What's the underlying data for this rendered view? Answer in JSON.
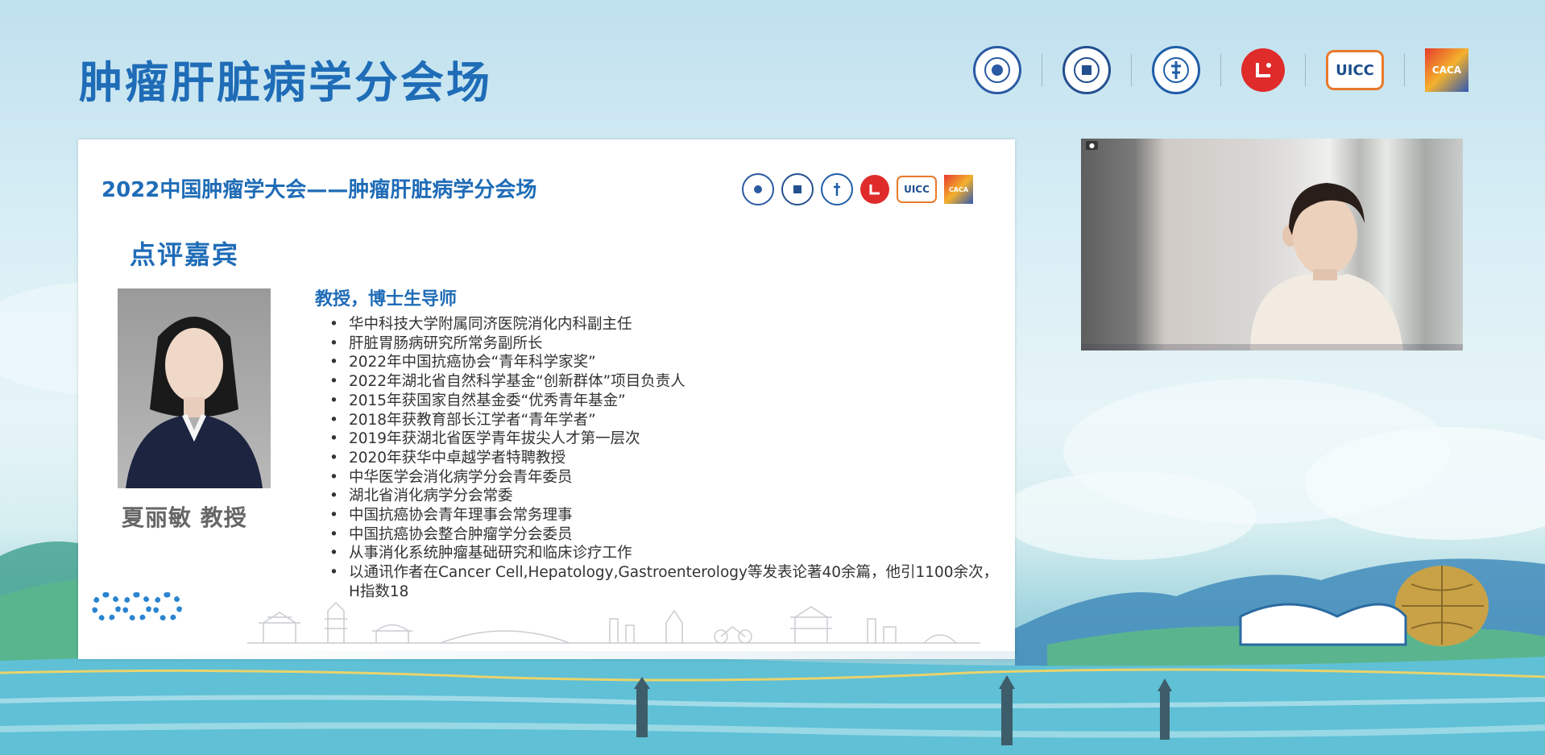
{
  "page": {
    "title": "肿瘤肝脏病学分会场"
  },
  "header_logos": [
    {
      "name": "university-seal-1-logo"
    },
    {
      "name": "university-seal-2-logo"
    },
    {
      "name": "medical-association-logo"
    },
    {
      "name": "red-circle-logo"
    },
    {
      "name": "uicc-logo",
      "text": "UICC"
    },
    {
      "name": "cace-logo",
      "text": "CACA"
    }
  ],
  "slide": {
    "title": "2022中国肿瘤学大会——肿瘤肝脏病学分会场",
    "section_heading": "点评嘉宾",
    "guest": {
      "name": "夏丽敏 教授",
      "title": "教授，博士生导师",
      "bio": [
        "华中科技大学附属同济医院消化内科副主任",
        "肝脏胃肠病研究所常务副所长",
        "2022年中国抗癌协会“青年科学家奖”",
        "2022年湖北省自然科学基金“创新群体”项目负责人",
        "2015年获国家自然基金委“优秀青年基金”",
        "2018年获教育部长江学者“青年学者”",
        "2019年获湖北省医学青年拔尖人才第一层次",
        "2020年获华中卓越学者特聘教授",
        "中华医学会消化病学分会青年委员",
        "湖北省消化病学分会常委",
        "中国抗癌协会青年理事会常务理事",
        "中国抗癌协会整合肿瘤学分会委员",
        "从事消化系统肿瘤基础研究和临床诊疗工作",
        "以通讯作者在Cancer Cell,Hepatology,Gastroenterology等发表论著40余篇，他引1100余次，H指数18"
      ]
    }
  },
  "colors": {
    "brand_blue": "#1f6cb7",
    "logo_red": "#e02b2b",
    "uicc_orange": "#e8792a"
  }
}
